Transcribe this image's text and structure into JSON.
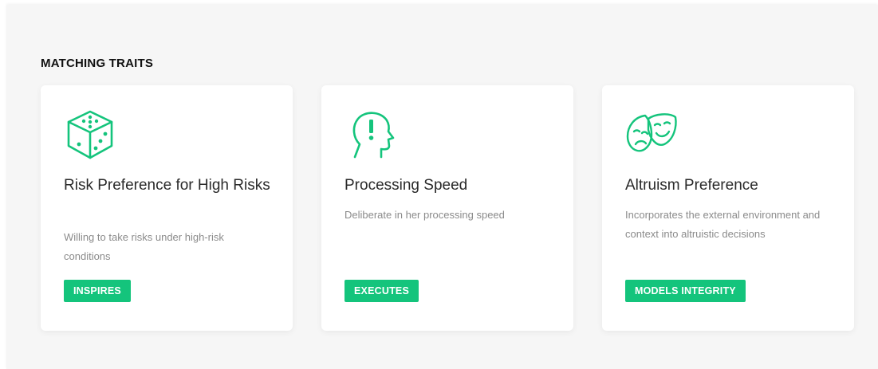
{
  "section": {
    "title": "MATCHING TRAITS"
  },
  "accent_color": "#14c47c",
  "cards": [
    {
      "icon": "dice-icon",
      "title": "Risk Preference for High Risks",
      "description": "Willing to take risks under high-risk conditions",
      "tag": "INSPIRES"
    },
    {
      "icon": "head-exclamation-icon",
      "title": "Processing Speed",
      "description": "Deliberate in her processing speed",
      "tag": "EXECUTES"
    },
    {
      "icon": "theater-masks-icon",
      "title": "Altruism Preference",
      "description": "Incorporates the external environment and context into altruistic decisions",
      "tag": "MODELS INTEGRITY"
    }
  ]
}
